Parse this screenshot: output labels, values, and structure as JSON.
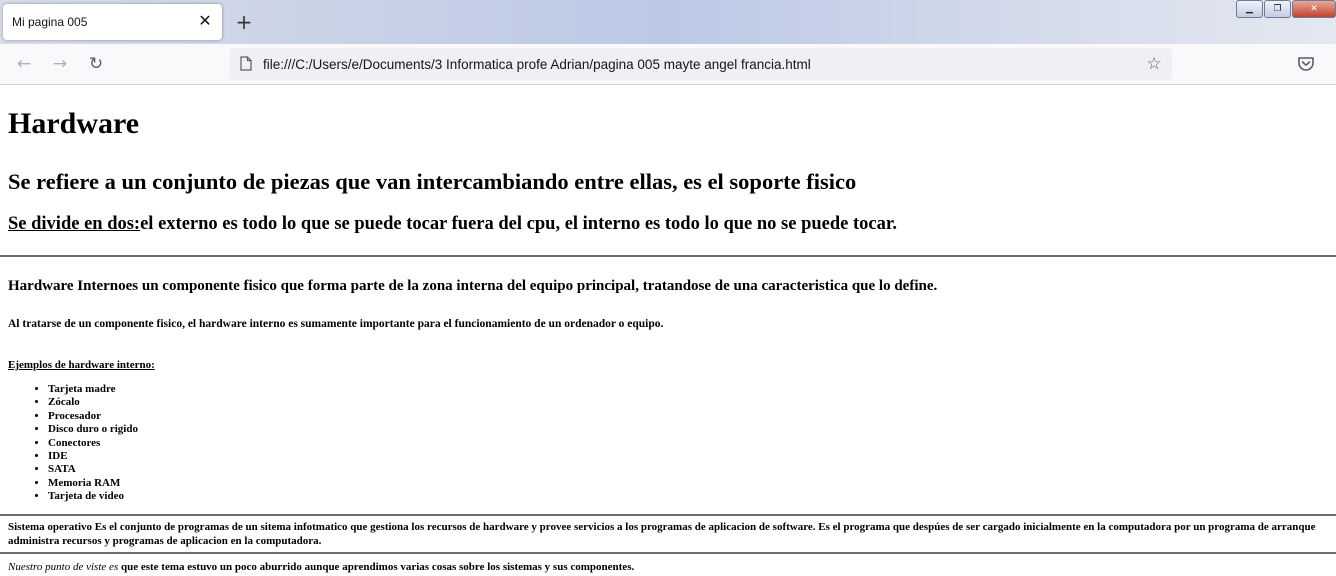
{
  "browser": {
    "tab_title": "Mi pagina 005",
    "close_glyph": "✕",
    "new_tab_glyph": "+",
    "back_glyph": "←",
    "forward_glyph": "→",
    "reload_glyph": "↻",
    "star_glyph": "☆",
    "minimize_glyph": "▁",
    "restore_glyph": "❐",
    "window_close_glyph": "✕",
    "url": "file:///C:/Users/e/Documents/3 Informatica profe Adrian/pagina 005 mayte angel francia.html",
    "icons": [
      "page-icon",
      "star-icon",
      "pocket-icon",
      "back-icon",
      "forward-icon",
      "reload-icon",
      "new-tab-icon"
    ]
  },
  "page": {
    "h1": "Hardware",
    "h2": "Se refiere a un conjunto de piezas que van intercambiando entre ellas, es el soporte fisico",
    "h3_underlined": "Se divide en dos:",
    "h3_rest": "el externo es todo lo que se puede tocar fuera del cpu, el interno es todo lo que no se puede tocar.",
    "h4": "Hardware Internoes un componente fisico que forma parte de la zona interna del equipo principal, tratandose de una caracteristica que lo define.",
    "h5": "Al tratarse de un componente fisico, el hardware interno es sumamente importante para el funcionamiento de un ordenador o equipo.",
    "examples_title": "Ejemplos de hardware interno:",
    "examples": [
      "Tarjeta madre",
      "Zócalo",
      "Procesador",
      "Disco duro o rigido",
      "Conectores",
      "IDE",
      "SATA",
      "Memoria RAM",
      "Tarjeta de video"
    ],
    "sysop": "Sistema operativo Es el conjunto de programas de un sitema infotmatico que gestiona los recursos de hardware y provee servicios a los programas de aplicacion de software. Es el programa que despúes de ser cargado inicialmente en la computadora por un programa de arranque administra recursos y programas de aplicacion en la computadora.",
    "opinion_italic": "Nuestro punto de viste es",
    "opinion_rest": " que este tema estuvo un poco aburrido aunque aprendimos varias cosas sobre los sistemas y sus componentes."
  }
}
